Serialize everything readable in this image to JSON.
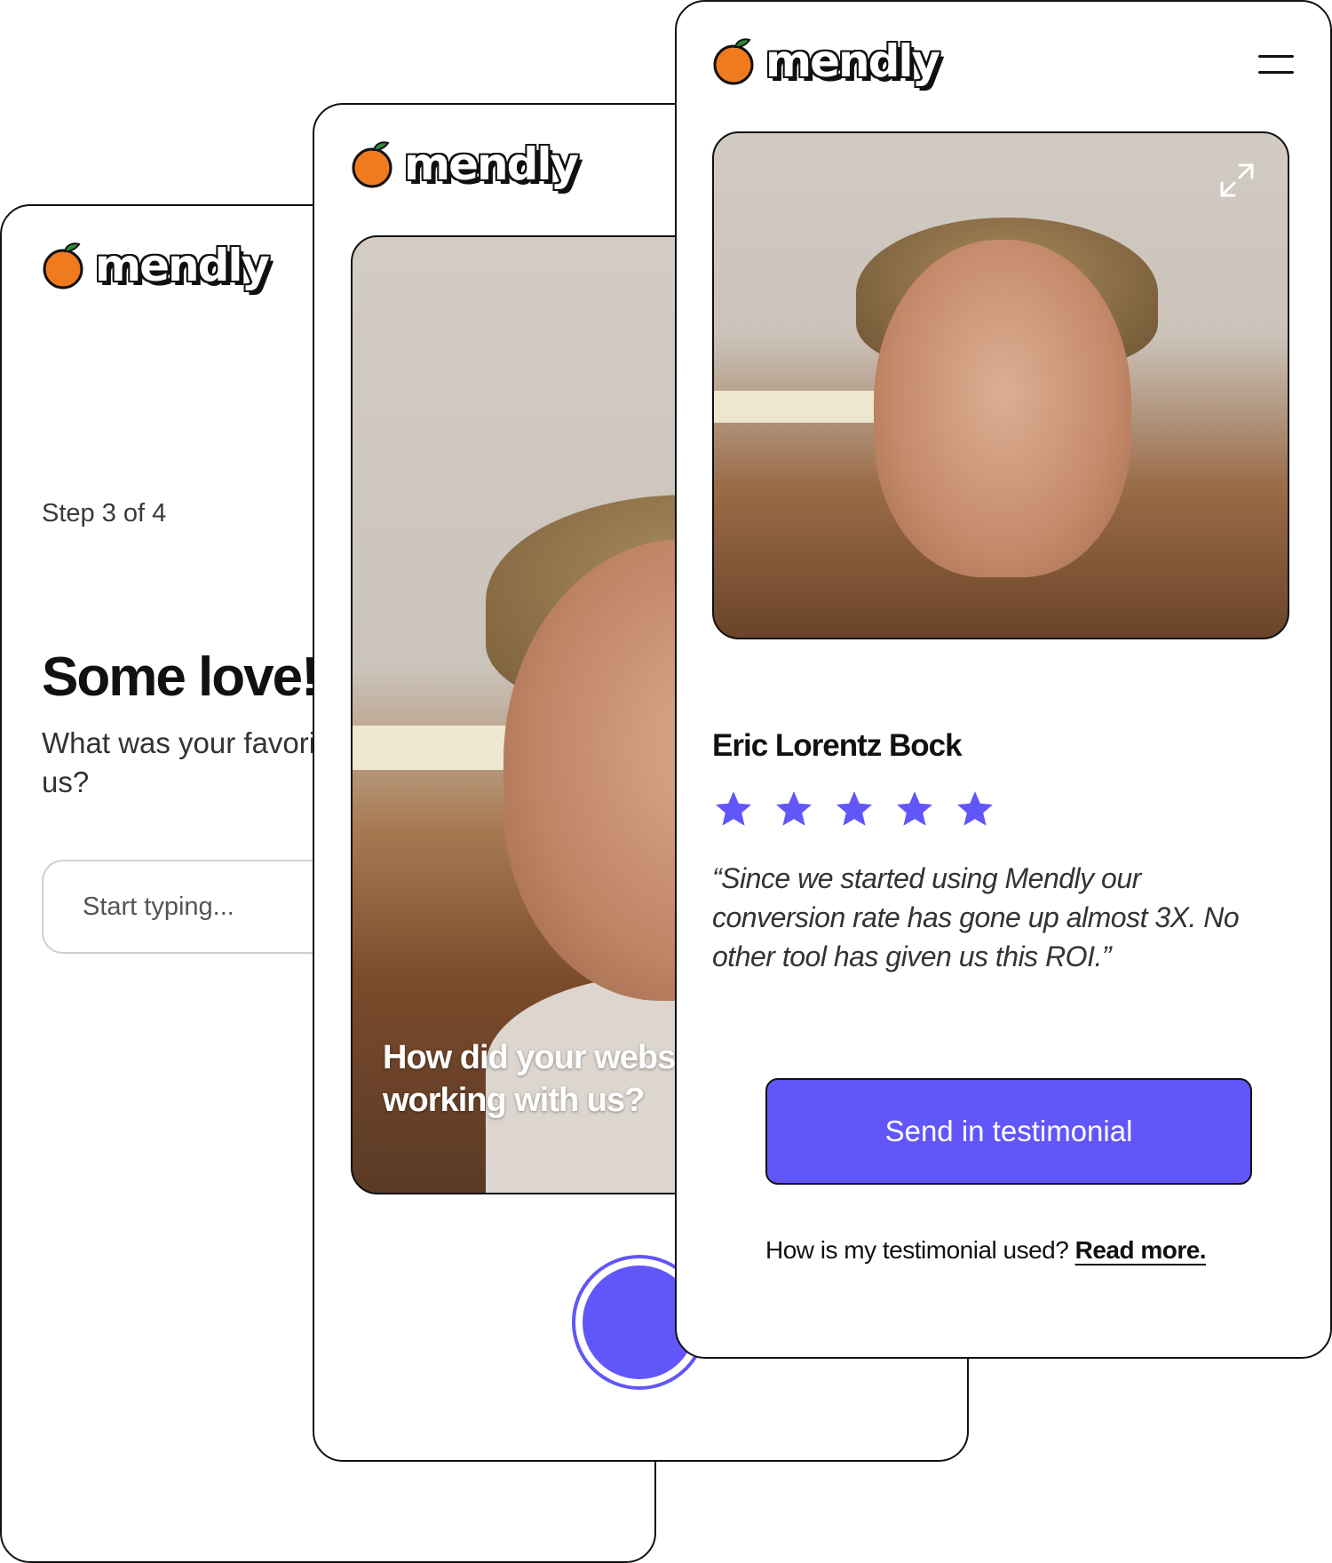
{
  "brand": {
    "name": "mendly",
    "accent": "#6156f9",
    "logo_fruit": "#f07a1e"
  },
  "card_step": {
    "step_label": "Step 3 of 4",
    "headline": "Some love!",
    "question": "What was your favorite part of working with us?",
    "input_placeholder": "Start typing..."
  },
  "card_video": {
    "caption": "How did your website look before working with us?",
    "record_button": "record-button"
  },
  "card_review": {
    "reviewer_name": "Eric Lorentz Bock",
    "rating": 5,
    "rating_max": 5,
    "quote": "“Since we started using Mendly our conversion rate has gone up almost 3X. No other tool has given us this ROI.”",
    "cta_label": "Send in testimonial",
    "footer_question": "How is my testimonial used?",
    "footer_link": "Read more."
  }
}
